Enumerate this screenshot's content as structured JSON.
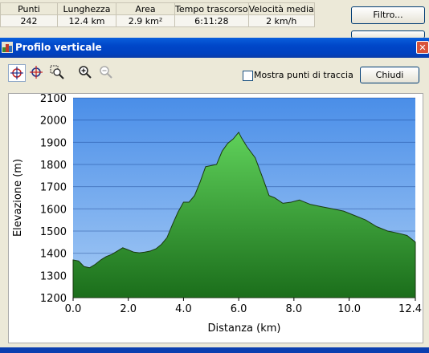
{
  "stats": {
    "headers": [
      "Punti",
      "Lunghezza",
      "Area",
      "Tempo trascorso",
      "Velocità media"
    ],
    "values": [
      "242",
      "12.4 km",
      "2.9 km²",
      "6:11:28",
      "2 km/h"
    ]
  },
  "filter_button": "Filtro...",
  "window": {
    "title": "Profilo verticale",
    "close": "✕"
  },
  "toolbar": {
    "show_points_label": "Mostra punti di traccia",
    "close_button": "Chiudi",
    "icons": [
      "crosshair-icon",
      "crosshair-move-icon",
      "zoom-region-icon",
      "zoom-in-icon",
      "zoom-out-icon"
    ]
  },
  "chart_data": {
    "type": "area",
    "xlabel": "Distanza   (km)",
    "ylabel": "Elevazione  (m)",
    "xlim": [
      0,
      12.4
    ],
    "ylim": [
      1200,
      2100
    ],
    "xticks": [
      "0.0",
      "2.0",
      "4.0",
      "6.0",
      "8.0",
      "10.0",
      "12.4"
    ],
    "yticks": [
      "1200",
      "1300",
      "1400",
      "1500",
      "1600",
      "1700",
      "1800",
      "1900",
      "2000",
      "2100"
    ],
    "grid": true,
    "x": [
      0.0,
      0.2,
      0.4,
      0.6,
      0.8,
      1.0,
      1.2,
      1.4,
      1.6,
      1.8,
      2.0,
      2.2,
      2.4,
      2.6,
      2.8,
      3.0,
      3.2,
      3.4,
      3.6,
      3.8,
      4.0,
      4.2,
      4.4,
      4.6,
      4.8,
      5.0,
      5.2,
      5.4,
      5.6,
      5.8,
      6.0,
      6.1,
      6.3,
      6.6,
      6.9,
      7.1,
      7.3,
      7.6,
      7.9,
      8.2,
      8.6,
      9.0,
      9.4,
      9.8,
      10.2,
      10.6,
      11.0,
      11.4,
      11.8,
      12.1,
      12.4
    ],
    "y": [
      1370,
      1365,
      1340,
      1335,
      1350,
      1370,
      1385,
      1395,
      1410,
      1425,
      1415,
      1405,
      1402,
      1405,
      1410,
      1420,
      1440,
      1470,
      1530,
      1585,
      1630,
      1630,
      1660,
      1720,
      1790,
      1795,
      1800,
      1860,
      1895,
      1915,
      1945,
      1920,
      1880,
      1830,
      1730,
      1660,
      1650,
      1625,
      1630,
      1640,
      1620,
      1610,
      1600,
      1590,
      1570,
      1550,
      1520,
      1500,
      1490,
      1480,
      1450
    ],
    "colors": {
      "sky_top": "#4a8ee8",
      "sky_bottom": "#a6cbf5",
      "hill_light": "#5fd15a",
      "hill_dark": "#1b6e1b"
    }
  }
}
